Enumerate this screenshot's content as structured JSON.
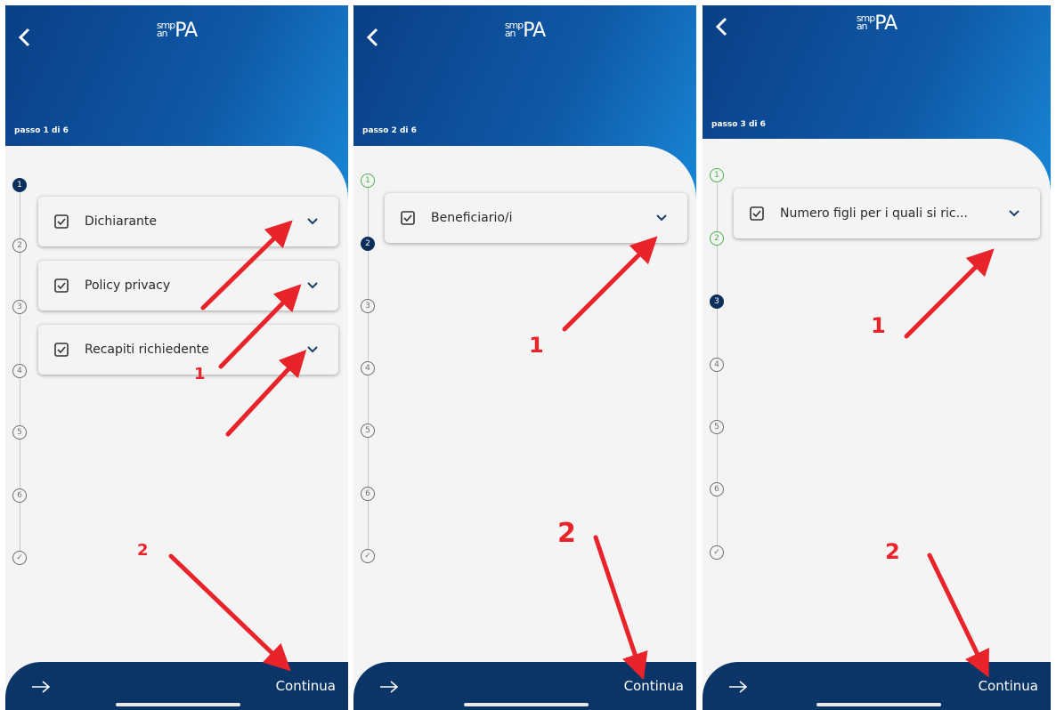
{
  "app": {
    "logo_top": "smp",
    "logo_bottom": "aiiPA",
    "logo_main": "PA"
  },
  "panels": [
    {
      "step_label": "passo 1 di 6",
      "steps": [
        "1",
        "2",
        "3",
        "4",
        "5",
        "6",
        "✓"
      ],
      "cards": [
        "Dichiarante",
        "Policy privacy",
        "Recapiti richiedente"
      ],
      "continue_label": "Continua",
      "annotation_1": "1",
      "annotation_2": "2"
    },
    {
      "step_label": "passo 2 di 6",
      "steps": [
        "1",
        "2",
        "3",
        "4",
        "5",
        "6",
        "✓"
      ],
      "cards": [
        "Beneficiario/i"
      ],
      "continue_label": "Continua",
      "annotation_1": "1",
      "annotation_2": "2"
    },
    {
      "step_label": "passo 3 di 6",
      "steps": [
        "1",
        "2",
        "3",
        "4",
        "5",
        "6",
        "✓"
      ],
      "cards": [
        "Numero figli per i quali si ric..."
      ],
      "continue_label": "Continua",
      "annotation_1": "1",
      "annotation_2": "2"
    }
  ],
  "colors": {
    "header_dark": "#0a3f85",
    "header_light": "#1a8fe0",
    "footer": "#0b3566",
    "active_step": "#0b2f5c",
    "done_step": "#4caf50",
    "annotation": "#e8232a"
  }
}
